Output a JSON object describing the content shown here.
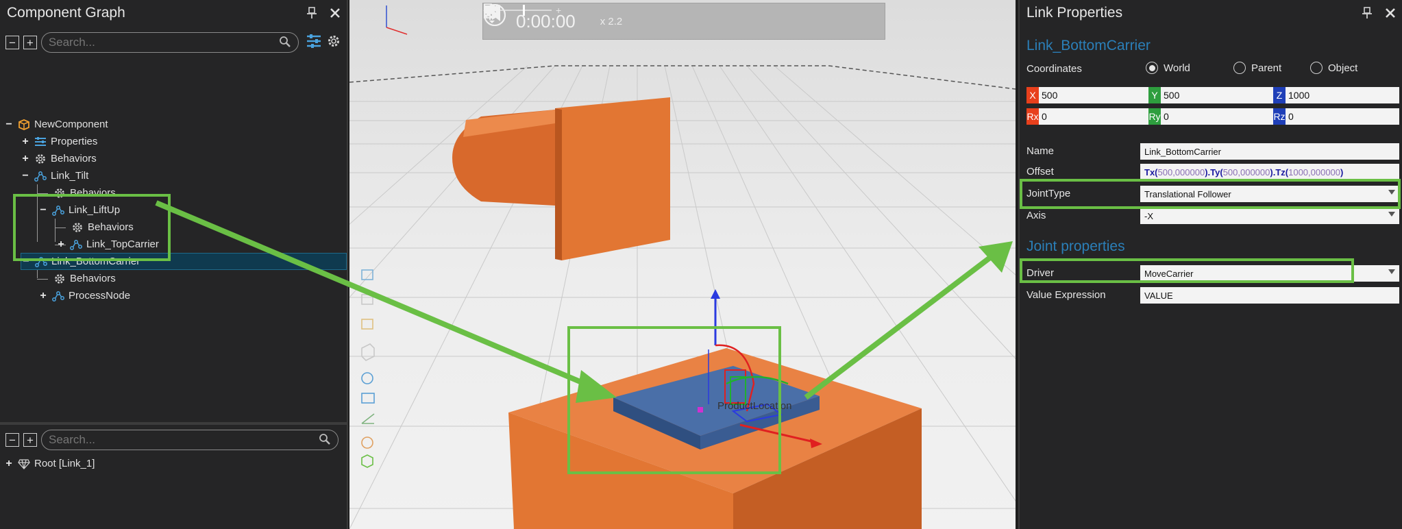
{
  "component_graph": {
    "title": "Component Graph",
    "search_placeholder": "Search...",
    "tree": {
      "root": "NewComponent",
      "properties": "Properties",
      "behaviors": "Behaviors",
      "link_tilt": "Link_Tilt",
      "link_tilt_behaviors": "Behaviors",
      "link_liftup": "Link_LiftUp",
      "link_liftup_behaviors": "Behaviors",
      "link_topcarrier": "Link_TopCarrier",
      "link_bottomcarrier": "Link_BottomCarrier",
      "link_bottomcarrier_behaviors": "Behaviors",
      "processnode": "ProcessNode"
    },
    "lower_search_placeholder": "Search...",
    "lower_tree_root": "Root [Link_1]"
  },
  "viewport": {
    "time": "0:00:00",
    "speed": "x 2.2",
    "frame_label": "ProductLocation"
  },
  "link_properties": {
    "title": "Link Properties",
    "link_name": "Link_BottomCarrier",
    "coordinates_label": "Coordinates",
    "coordinate_options": [
      "World",
      "Parent",
      "Object"
    ],
    "selected_coordinate": "World",
    "x": "500",
    "y": "500",
    "z": "1000",
    "rx": "0",
    "ry": "0",
    "rz": "0",
    "tags": {
      "x": "X",
      "y": "Y",
      "z": "Z",
      "rx": "Rx",
      "ry": "Ry",
      "rz": "Rz"
    },
    "name_label": "Name",
    "name_value": "Link_BottomCarrier",
    "offset_label": "Offset",
    "offset_parts": [
      "Tx(",
      "500,000000",
      ").",
      "Ty(",
      "500,000000",
      ").",
      "Tz(",
      "1000,000000",
      ")"
    ],
    "jointtype_label": "JointType",
    "jointtype_value": "Translational Follower",
    "axis_label": "Axis",
    "axis_value": "-X",
    "joint_section": "Joint properties",
    "driver_label": "Driver",
    "driver_value": "MoveCarrier",
    "value_expression_label": "Value Expression",
    "value_expression_value": "VALUE"
  },
  "colors": {
    "highlight": "#6abf45",
    "accent": "#2b7fb8",
    "orange": "#e0702f",
    "x_tag": "#e8401c",
    "y_tag": "#2e9e3e",
    "z_tag": "#1f3fb8"
  },
  "icons": [
    "pin-icon",
    "close-icon",
    "collapse-icon",
    "expand-icon",
    "search-icon",
    "filter-icon",
    "gear-icon",
    "component-icon",
    "properties-icon",
    "behaviors-icon",
    "link-icon",
    "radio-icon"
  ]
}
